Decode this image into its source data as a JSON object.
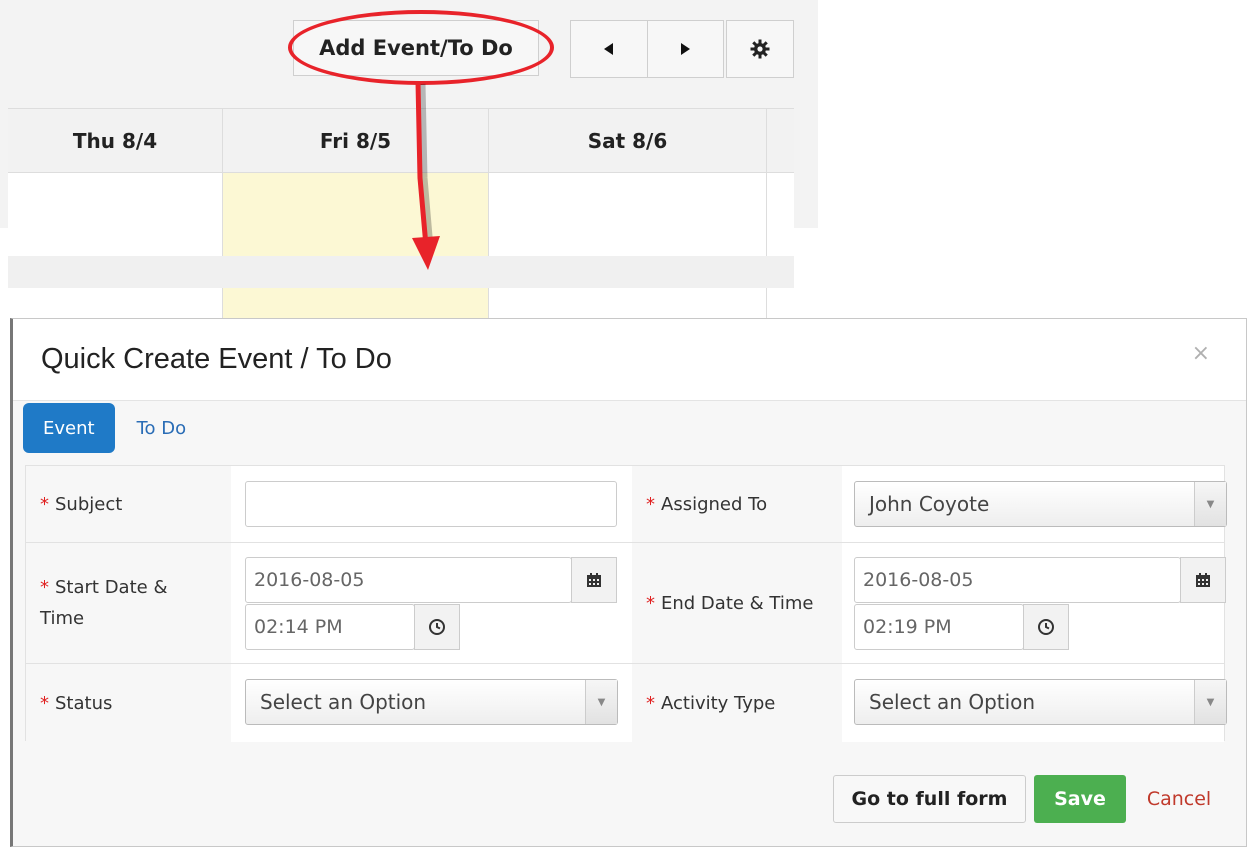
{
  "toolbar": {
    "add_label": "Add Event/To Do",
    "prev_icon": "◀",
    "next_icon": "▶",
    "settings_icon": "gear-icon"
  },
  "calendar": {
    "days": [
      "Thu 8/4",
      "Fri 8/5",
      "Sat 8/6"
    ],
    "today_color": "#fcf8d4"
  },
  "annotation": {
    "color": "#e8232a"
  },
  "modal": {
    "title": "Quick Create Event / To Do",
    "close": "×",
    "tabs": [
      {
        "label": "Event",
        "active": true
      },
      {
        "label": "To Do",
        "active": false
      }
    ],
    "fields": {
      "subject": {
        "label": "Subject",
        "value": ""
      },
      "assigned_to": {
        "label": "Assigned To",
        "value": "John Coyote"
      },
      "start": {
        "label_line1": "Start Date &",
        "label_line2": "Time",
        "date": "2016-08-05",
        "time": "02:14 PM"
      },
      "end": {
        "label": "End Date & Time",
        "date": "2016-08-05",
        "time": "02:19 PM"
      },
      "status": {
        "label": "Status",
        "value": "Select an Option"
      },
      "activity_type": {
        "label": "Activity Type",
        "value": "Select an Option"
      }
    },
    "required_marker": "*",
    "buttons": {
      "full_form": "Go to full form",
      "save": "Save",
      "cancel": "Cancel"
    },
    "colors": {
      "accent": "#1f7ac7",
      "save": "#4caf50",
      "cancel": "#c0392b"
    }
  }
}
